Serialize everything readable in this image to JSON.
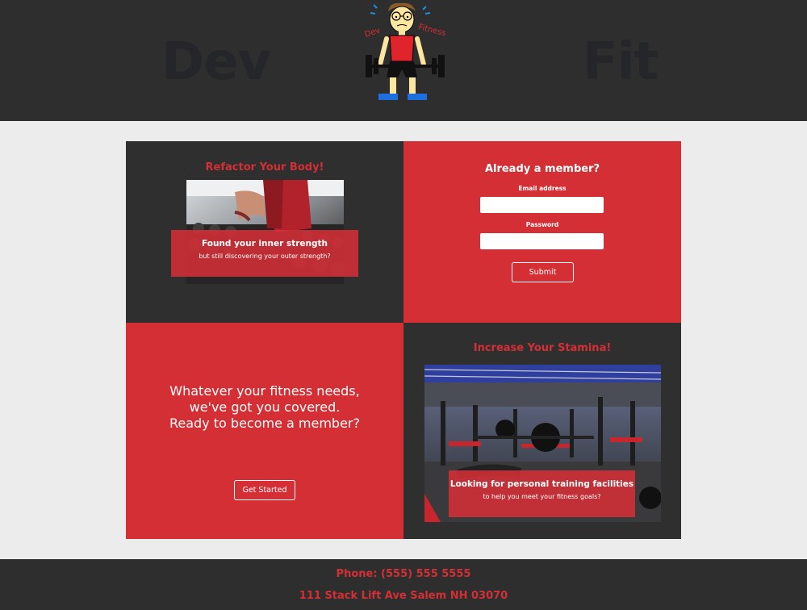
{
  "header": {
    "brand_left": "Dev",
    "brand_right": "Fit",
    "logo_text_left": "Dev",
    "logo_text_right": "Fitness"
  },
  "panels": {
    "refactor": {
      "heading": "Refactor Your Body!",
      "caption_title": "Found your inner strength",
      "caption_sub": "but still discovering your outer strength?"
    },
    "login": {
      "heading": "Already a member?",
      "email_label": "Email address",
      "email_value": "",
      "password_label": "Password",
      "password_value": "",
      "submit_label": "Submit"
    },
    "pitch": {
      "line1": "Whatever your fitness needs,",
      "line2": "we've got you covered.",
      "line3": "Ready to become a member?",
      "button_label": "Get Started"
    },
    "stamina": {
      "heading": "Increase Your Stamina!",
      "caption_title": "Looking for personal training facilities",
      "caption_sub": "to help you meet your fitness goals?"
    }
  },
  "footer": {
    "phone": "Phone: (555) 555 5555",
    "address": "111 Stack Lift Ave Salem NH 03070"
  },
  "colors": {
    "accent": "#d42f35",
    "dark": "#2f2f2f",
    "background": "#ececec"
  }
}
